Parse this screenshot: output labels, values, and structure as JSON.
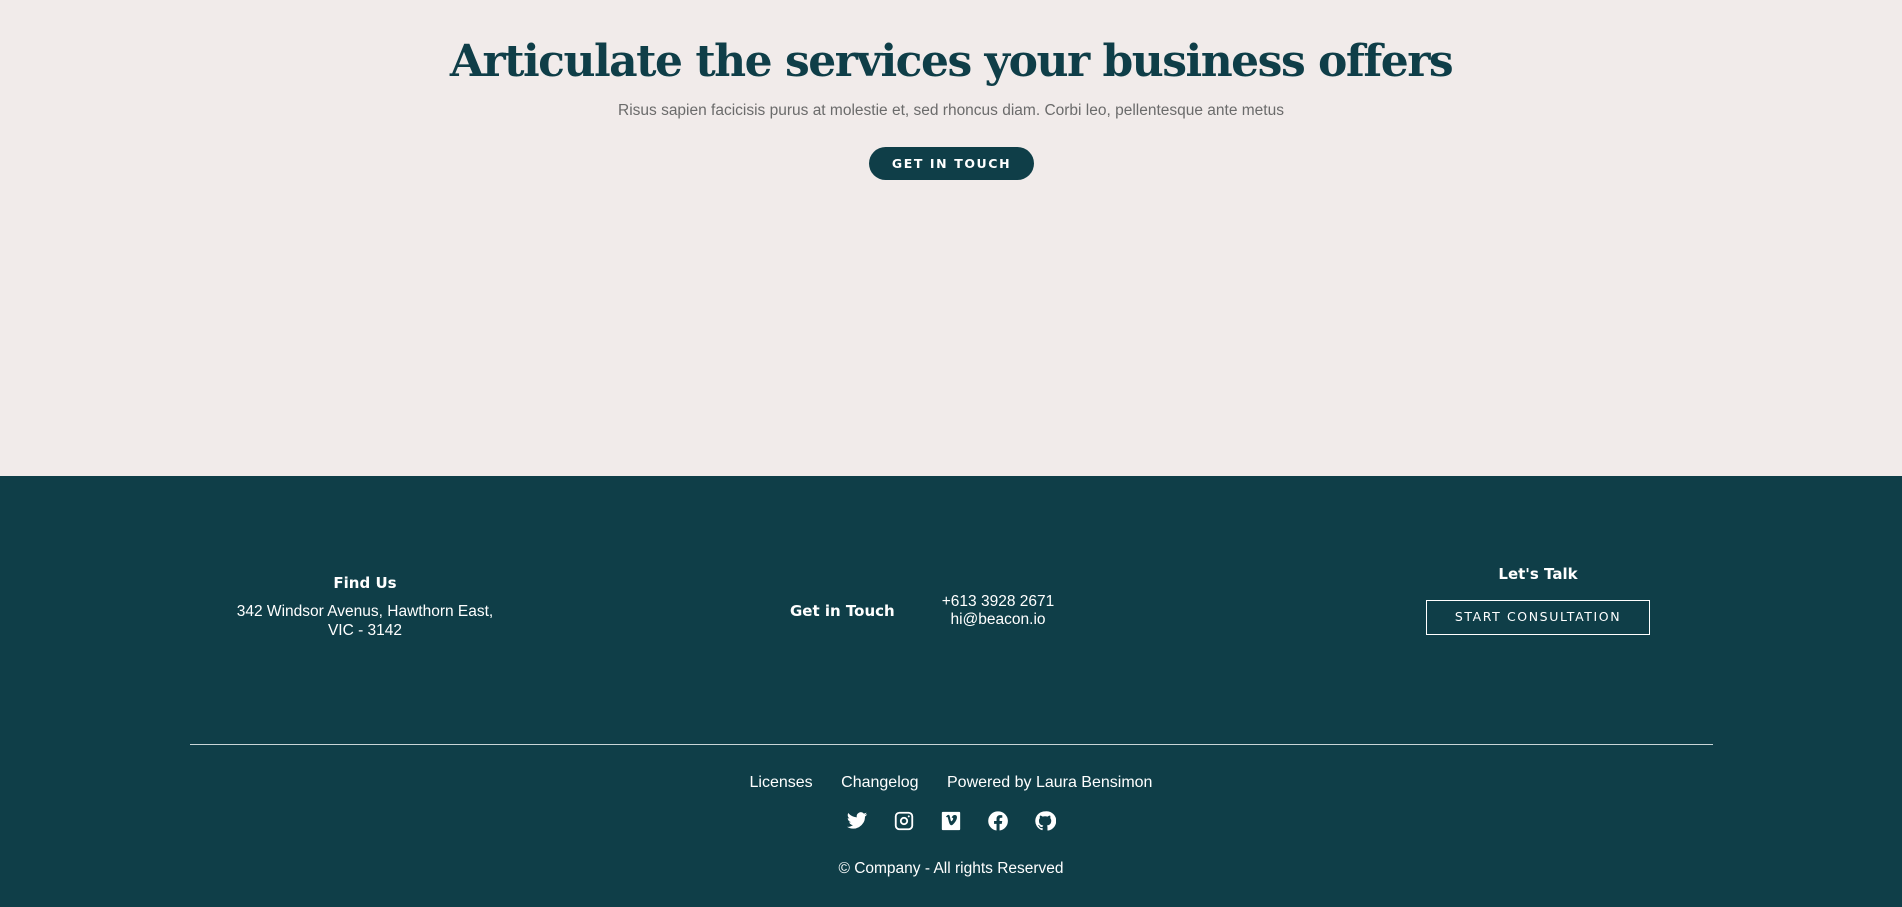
{
  "hero": {
    "title": "Articulate the services your business offers",
    "subtitle": "Risus sapien facicisis purus at molestie et, sed rhoncus diam. Corbi leo, pellentesque ante metus",
    "cta_label": "GET IN TOUCH"
  },
  "footer": {
    "find_us": {
      "title": "Find Us",
      "address_line1": "342 Windsor Avenus, Hawthorn East,",
      "address_line2": "VIC - 3142"
    },
    "get_in_touch": {
      "title": "Get in Touch",
      "phone": "+613 3928 2671",
      "email": "hi@beacon.io"
    },
    "lets_talk": {
      "title": "Let's Talk",
      "button_label": "START CONSULTATION"
    },
    "links": [
      "Licenses",
      "Changelog",
      "Powered by Laura Bensimon"
    ],
    "socials": [
      "twitter-icon",
      "instagram-icon",
      "vimeo-icon",
      "facebook-icon",
      "github-icon"
    ],
    "copyright": "© Company - All rights Reserved"
  },
  "colors": {
    "background": "#f1ebea",
    "primary": "#0f3e48",
    "text_muted": "#6b6b6b"
  }
}
